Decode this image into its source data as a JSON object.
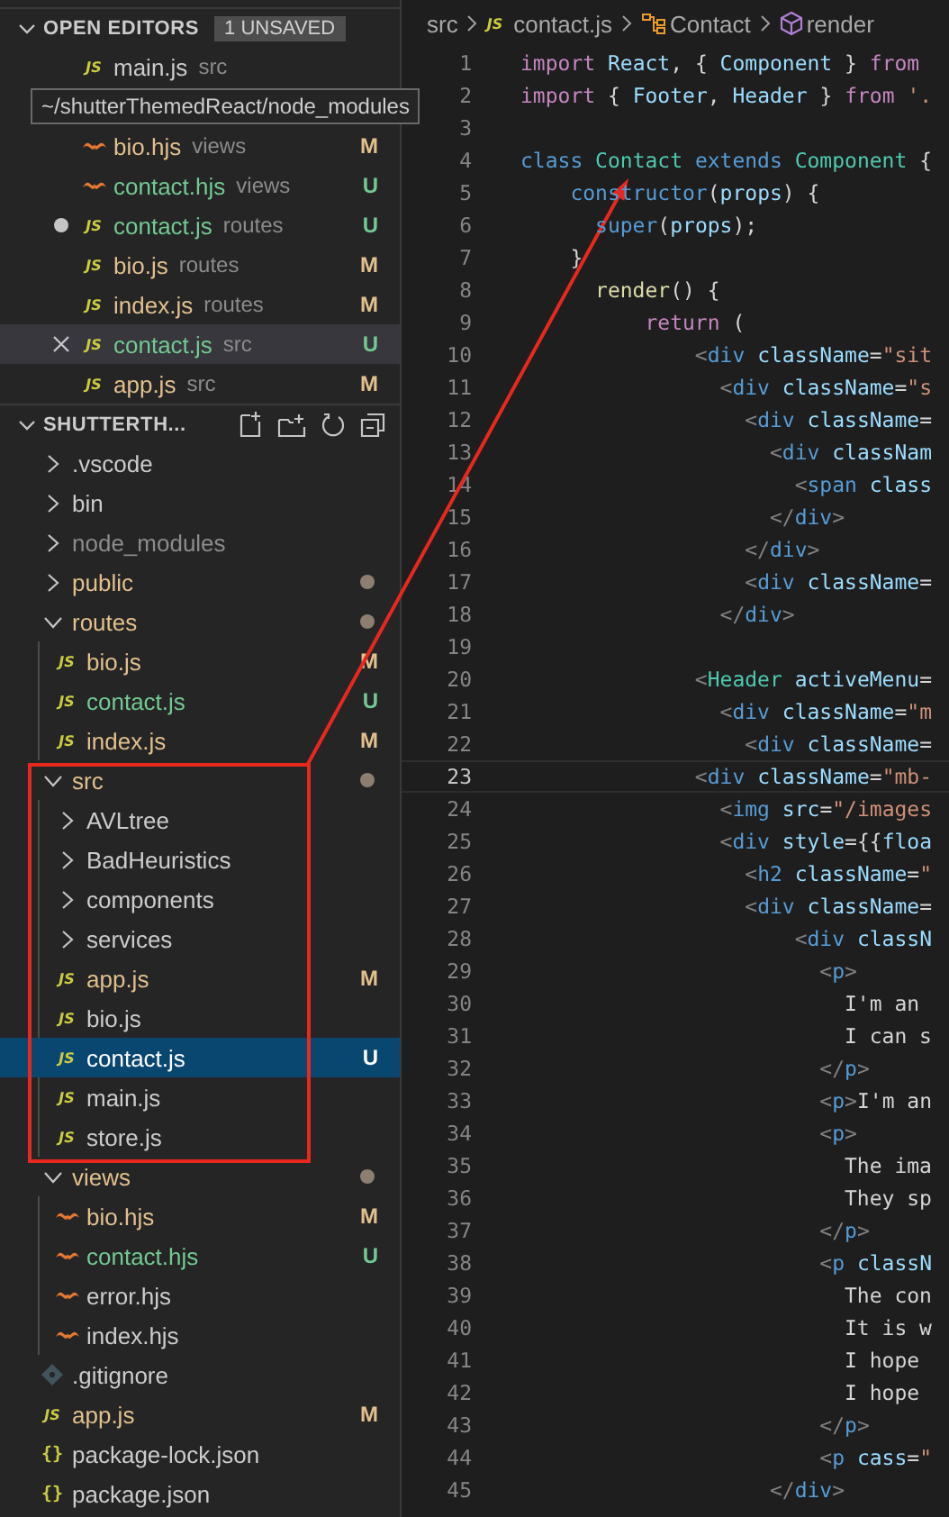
{
  "open_editors": {
    "title": "OPEN EDITORS",
    "badge": "1 UNSAVED",
    "expanded": true,
    "items": [
      {
        "name": "main.js",
        "folder": "src",
        "kind": "js",
        "glyph": "JS",
        "dirty": false,
        "selected": false
      },
      {
        "kind": "tooltip",
        "text": "~/shutterThemedReact/node_modules"
      },
      {
        "name": "bio.hjs",
        "folder": "views",
        "kind": "hbs",
        "color": "#e2c08d",
        "status": "M",
        "dirty": false,
        "selected": false
      },
      {
        "name": "contact.hjs",
        "folder": "views",
        "kind": "hbs",
        "color": "#73c991",
        "status": "U",
        "dirty": false,
        "selected": false
      },
      {
        "name": "contact.js",
        "folder": "routes",
        "kind": "js",
        "glyph": "JS",
        "color": "#73c991",
        "status": "U",
        "dirty": true,
        "selected": false
      },
      {
        "name": "bio.js",
        "folder": "routes",
        "kind": "js",
        "glyph": "JS",
        "color": "#e2c08d",
        "status": "M",
        "dirty": false,
        "selected": false
      },
      {
        "name": "index.js",
        "folder": "routes",
        "kind": "js",
        "glyph": "JS",
        "color": "#e2c08d",
        "status": "M",
        "dirty": false,
        "selected": false
      },
      {
        "name": "contact.js",
        "folder": "src",
        "kind": "js",
        "glyph": "JS",
        "color": "#73c991",
        "status": "U",
        "dirty": false,
        "selected": true
      },
      {
        "name": "app.js",
        "folder": "src",
        "kind": "js",
        "glyph": "JS",
        "color": "#e2c08d",
        "status": "M",
        "dirty": false,
        "selected": false
      }
    ]
  },
  "explorer": {
    "title": "SHUTTERTH...",
    "expanded": true,
    "tree": [
      {
        "name": ".vscode",
        "kind": "folder",
        "expanded": false,
        "selected": false
      },
      {
        "name": "bin",
        "kind": "folder",
        "expanded": false,
        "selected": false
      },
      {
        "name": "node_modules",
        "kind": "folder",
        "expanded": false,
        "ignored": true,
        "selected": false
      },
      {
        "name": "public",
        "kind": "folder",
        "expanded": false,
        "color": "#e2c08d",
        "dot": true,
        "selected": false
      },
      {
        "name": "routes",
        "kind": "folder",
        "expanded": true,
        "color": "#e2c08d",
        "dot": true,
        "selected": false,
        "children": [
          {
            "name": "bio.js",
            "kind": "js",
            "glyph": "JS",
            "color": "#e2c08d",
            "status": "M",
            "selected": false
          },
          {
            "name": "contact.js",
            "kind": "js",
            "glyph": "JS",
            "color": "#73c991",
            "status": "U",
            "selected": false
          },
          {
            "name": "index.js",
            "kind": "js",
            "glyph": "JS",
            "color": "#e2c08d",
            "status": "M",
            "selected": false
          }
        ]
      },
      {
        "name": "src",
        "kind": "folder",
        "expanded": true,
        "color": "#e2c08d",
        "dot": true,
        "selected": false,
        "children": [
          {
            "name": "AVLtree",
            "kind": "folder",
            "expanded": false,
            "selected": false
          },
          {
            "name": "BadHeuristics",
            "kind": "folder",
            "expanded": false,
            "selected": false
          },
          {
            "name": "components",
            "kind": "folder",
            "expanded": false,
            "selected": false
          },
          {
            "name": "services",
            "kind": "folder",
            "expanded": false,
            "selected": false
          },
          {
            "name": "app.js",
            "kind": "js",
            "glyph": "JS",
            "color": "#e2c08d",
            "status": "M",
            "selected": false
          },
          {
            "name": "bio.js",
            "kind": "js",
            "glyph": "JS",
            "selected": false
          },
          {
            "name": "contact.js",
            "kind": "js",
            "glyph": "JS",
            "status": "U",
            "selected": true
          },
          {
            "name": "main.js",
            "kind": "js",
            "glyph": "JS",
            "selected": false
          },
          {
            "name": "store.js",
            "kind": "js",
            "glyph": "JS",
            "selected": false
          }
        ]
      },
      {
        "name": "views",
        "kind": "folder",
        "expanded": true,
        "color": "#e2c08d",
        "dot": true,
        "selected": false,
        "children": [
          {
            "name": "bio.hjs",
            "kind": "hbs",
            "color": "#e2c08d",
            "status": "M",
            "selected": false
          },
          {
            "name": "contact.hjs",
            "kind": "hbs",
            "color": "#73c991",
            "status": "U",
            "selected": false
          },
          {
            "name": "error.hjs",
            "kind": "hbs",
            "selected": false
          },
          {
            "name": "index.hjs",
            "kind": "hbs",
            "selected": false
          }
        ]
      },
      {
        "name": ".gitignore",
        "kind": "git",
        "selected": false
      },
      {
        "name": "app.js",
        "kind": "js",
        "glyph": "JS",
        "color": "#e2c08d",
        "status": "M",
        "selected": false
      },
      {
        "name": "package-lock.json",
        "kind": "json",
        "glyph": "{}",
        "selected": false
      },
      {
        "name": "package.json",
        "kind": "json",
        "glyph": "{}",
        "selected": false
      }
    ]
  },
  "breadcrumb": [
    {
      "kind": "folder",
      "text": "src"
    },
    {
      "kind": "js",
      "glyph": "JS",
      "text": "contact.js"
    },
    {
      "kind": "class",
      "text": "Contact"
    },
    {
      "kind": "method",
      "text": "render"
    }
  ],
  "code": [
    {
      "n": "1",
      "active": false,
      "tokens": [
        {
          "kind": "kw",
          "text": "import"
        },
        {
          "kind": "var",
          "text": " React"
        },
        {
          "kind": "p",
          "text": ", { "
        },
        {
          "kind": "var",
          "text": "Component"
        },
        {
          "kind": "p",
          "text": " } "
        },
        {
          "kind": "kw",
          "text": "from"
        }
      ]
    },
    {
      "n": "2",
      "active": false,
      "tokens": [
        {
          "kind": "kw",
          "text": "import"
        },
        {
          "kind": "p",
          "text": " { "
        },
        {
          "kind": "var",
          "text": "Footer"
        },
        {
          "kind": "p",
          "text": ", "
        },
        {
          "kind": "var",
          "text": "Header"
        },
        {
          "kind": "p",
          "text": " } "
        },
        {
          "kind": "kw",
          "text": "from"
        },
        {
          "kind": "str",
          "text": " '."
        }
      ]
    },
    {
      "n": "3",
      "active": false
    },
    {
      "n": "4",
      "active": false,
      "tokens": [
        {
          "kind": "st",
          "text": "class"
        },
        {
          "kind": "ty",
          "text": " Contact"
        },
        {
          "kind": "st",
          "text": " extends"
        },
        {
          "kind": "ty",
          "text": " Component"
        },
        {
          "kind": "p",
          "text": " {"
        }
      ]
    },
    {
      "n": "5",
      "active": false,
      "tokens": [
        {
          "kind": "st",
          "text": "    constructor"
        },
        {
          "kind": "p",
          "text": "("
        },
        {
          "kind": "var",
          "text": "props"
        },
        {
          "kind": "p",
          "text": ") {"
        }
      ]
    },
    {
      "n": "6",
      "active": false,
      "tokens": [
        {
          "kind": "st",
          "text": "      super"
        },
        {
          "kind": "p",
          "text": "("
        },
        {
          "kind": "var",
          "text": "props"
        },
        {
          "kind": "p",
          "text": ");"
        }
      ]
    },
    {
      "n": "7",
      "active": false,
      "tokens": [
        {
          "kind": "p",
          "text": "    }"
        }
      ]
    },
    {
      "n": "8",
      "active": false,
      "tokens": [
        {
          "kind": "fn",
          "text": "      render"
        },
        {
          "kind": "p",
          "text": "() {"
        }
      ]
    },
    {
      "n": "9",
      "active": false,
      "tokens": [
        {
          "kind": "kw",
          "text": "          return"
        },
        {
          "kind": "p",
          "text": " ("
        }
      ]
    },
    {
      "n": "10",
      "active": false,
      "tokens": [
        {
          "kind": "tb",
          "text": "              <"
        },
        {
          "kind": "tag",
          "text": "div"
        },
        {
          "kind": "attr",
          "text": " className"
        },
        {
          "kind": "p",
          "text": "="
        },
        {
          "kind": "str",
          "text": "\"sit"
        }
      ]
    },
    {
      "n": "11",
      "active": false,
      "tokens": [
        {
          "kind": "tb",
          "text": "                <"
        },
        {
          "kind": "tag",
          "text": "div"
        },
        {
          "kind": "attr",
          "text": " className"
        },
        {
          "kind": "p",
          "text": "="
        },
        {
          "kind": "str",
          "text": "\"s"
        }
      ]
    },
    {
      "n": "12",
      "active": false,
      "tokens": [
        {
          "kind": "tb",
          "text": "                  <"
        },
        {
          "kind": "tag",
          "text": "div"
        },
        {
          "kind": "attr",
          "text": " className"
        },
        {
          "kind": "p",
          "text": "="
        }
      ]
    },
    {
      "n": "13",
      "active": false,
      "tokens": [
        {
          "kind": "tb",
          "text": "                    <"
        },
        {
          "kind": "tag",
          "text": "div"
        },
        {
          "kind": "attr",
          "text": " classNam"
        }
      ]
    },
    {
      "n": "14",
      "active": false,
      "tokens": [
        {
          "kind": "tb",
          "text": "                      <"
        },
        {
          "kind": "tag",
          "text": "span"
        },
        {
          "kind": "attr",
          "text": " class"
        }
      ]
    },
    {
      "n": "15",
      "active": false,
      "tokens": [
        {
          "kind": "tb",
          "text": "                    </"
        },
        {
          "kind": "tag",
          "text": "div"
        },
        {
          "kind": "tb",
          "text": ">"
        }
      ]
    },
    {
      "n": "16",
      "active": false,
      "tokens": [
        {
          "kind": "tb",
          "text": "                  </"
        },
        {
          "kind": "tag",
          "text": "div"
        },
        {
          "kind": "tb",
          "text": ">"
        }
      ]
    },
    {
      "n": "17",
      "active": false,
      "tokens": [
        {
          "kind": "tb",
          "text": "                  <"
        },
        {
          "kind": "tag",
          "text": "div"
        },
        {
          "kind": "attr",
          "text": " className"
        },
        {
          "kind": "p",
          "text": "="
        }
      ]
    },
    {
      "n": "18",
      "active": false,
      "tokens": [
        {
          "kind": "tb",
          "text": "                </"
        },
        {
          "kind": "tag",
          "text": "div"
        },
        {
          "kind": "tb",
          "text": ">"
        }
      ]
    },
    {
      "n": "19",
      "active": false
    },
    {
      "n": "20",
      "active": false,
      "tokens": [
        {
          "kind": "tb",
          "text": "              <"
        },
        {
          "kind": "ty",
          "text": "Header"
        },
        {
          "kind": "attr",
          "text": " activeMenu"
        },
        {
          "kind": "p",
          "text": "="
        }
      ]
    },
    {
      "n": "21",
      "active": false,
      "tokens": [
        {
          "kind": "tb",
          "text": "                <"
        },
        {
          "kind": "tag",
          "text": "div"
        },
        {
          "kind": "attr",
          "text": " className"
        },
        {
          "kind": "p",
          "text": "="
        },
        {
          "kind": "str",
          "text": "\"m"
        }
      ]
    },
    {
      "n": "22",
      "active": false,
      "tokens": [
        {
          "kind": "tb",
          "text": "                  <"
        },
        {
          "kind": "tag",
          "text": "div"
        },
        {
          "kind": "attr",
          "text": " className"
        },
        {
          "kind": "p",
          "text": "="
        }
      ]
    },
    {
      "n": "23",
      "active": true,
      "tokens": [
        {
          "kind": "tb",
          "text": "              <"
        },
        {
          "kind": "tag",
          "text": "div"
        },
        {
          "kind": "attr",
          "text": " className"
        },
        {
          "kind": "p",
          "text": "="
        },
        {
          "kind": "str",
          "text": "\"mb-"
        }
      ]
    },
    {
      "n": "24",
      "active": false,
      "tokens": [
        {
          "kind": "tb",
          "text": "                <"
        },
        {
          "kind": "tag",
          "text": "img"
        },
        {
          "kind": "attr",
          "text": " src"
        },
        {
          "kind": "p",
          "text": "="
        },
        {
          "kind": "str",
          "text": "\"/images"
        }
      ]
    },
    {
      "n": "25",
      "active": false,
      "tokens": [
        {
          "kind": "tb",
          "text": "                <"
        },
        {
          "kind": "tag",
          "text": "div"
        },
        {
          "kind": "attr",
          "text": " style"
        },
        {
          "kind": "p",
          "text": "={{"
        },
        {
          "kind": "attr",
          "text": "floa"
        }
      ]
    },
    {
      "n": "26",
      "active": false,
      "tokens": [
        {
          "kind": "tb",
          "text": "                  <"
        },
        {
          "kind": "tag",
          "text": "h2"
        },
        {
          "kind": "attr",
          "text": " className"
        },
        {
          "kind": "p",
          "text": "="
        },
        {
          "kind": "str",
          "text": "\""
        }
      ]
    },
    {
      "n": "27",
      "active": false,
      "tokens": [
        {
          "kind": "tb",
          "text": "                  <"
        },
        {
          "kind": "tag",
          "text": "div"
        },
        {
          "kind": "attr",
          "text": " className"
        },
        {
          "kind": "p",
          "text": "="
        }
      ]
    },
    {
      "n": "28",
      "active": false,
      "tokens": [
        {
          "kind": "tb",
          "text": "                      <"
        },
        {
          "kind": "tag",
          "text": "div"
        },
        {
          "kind": "attr",
          "text": " classN"
        }
      ]
    },
    {
      "n": "29",
      "active": false,
      "tokens": [
        {
          "kind": "tb",
          "text": "                        <"
        },
        {
          "kind": "tag",
          "text": "p"
        },
        {
          "kind": "tb",
          "text": ">"
        }
      ]
    },
    {
      "n": "30",
      "active": false,
      "tokens": [
        {
          "kind": "tx",
          "text": "                          I'm an"
        }
      ]
    },
    {
      "n": "31",
      "active": false,
      "tokens": [
        {
          "kind": "tx",
          "text": "                          I can s"
        }
      ]
    },
    {
      "n": "32",
      "active": false,
      "tokens": [
        {
          "kind": "tb",
          "text": "                        </"
        },
        {
          "kind": "tag",
          "text": "p"
        },
        {
          "kind": "tb",
          "text": ">"
        }
      ]
    },
    {
      "n": "33",
      "active": false,
      "tokens": [
        {
          "kind": "tb",
          "text": "                        <"
        },
        {
          "kind": "tag",
          "text": "p"
        },
        {
          "kind": "tb",
          "text": ">"
        },
        {
          "kind": "tx",
          "text": "I'm an"
        }
      ]
    },
    {
      "n": "34",
      "active": false,
      "tokens": [
        {
          "kind": "tb",
          "text": "                        <"
        },
        {
          "kind": "tag",
          "text": "p"
        },
        {
          "kind": "tb",
          "text": ">"
        }
      ]
    },
    {
      "n": "35",
      "active": false,
      "tokens": [
        {
          "kind": "tx",
          "text": "                          The ima"
        }
      ]
    },
    {
      "n": "36",
      "active": false,
      "tokens": [
        {
          "kind": "tx",
          "text": "                          They sp"
        }
      ]
    },
    {
      "n": "37",
      "active": false,
      "tokens": [
        {
          "kind": "tb",
          "text": "                        </"
        },
        {
          "kind": "tag",
          "text": "p"
        },
        {
          "kind": "tb",
          "text": ">"
        }
      ]
    },
    {
      "n": "38",
      "active": false,
      "tokens": [
        {
          "kind": "tb",
          "text": "                        <"
        },
        {
          "kind": "tag",
          "text": "p"
        },
        {
          "kind": "attr",
          "text": " classN"
        }
      ]
    },
    {
      "n": "39",
      "active": false,
      "tokens": [
        {
          "kind": "tx",
          "text": "                          The con"
        }
      ]
    },
    {
      "n": "40",
      "active": false,
      "tokens": [
        {
          "kind": "tx",
          "text": "                          It is w"
        }
      ]
    },
    {
      "n": "41",
      "active": false,
      "tokens": [
        {
          "kind": "tx",
          "text": "                          I hope"
        }
      ]
    },
    {
      "n": "42",
      "active": false,
      "tokens": [
        {
          "kind": "tx",
          "text": "                          I hope"
        }
      ]
    },
    {
      "n": "43",
      "active": false,
      "tokens": [
        {
          "kind": "tb",
          "text": "                        </"
        },
        {
          "kind": "tag",
          "text": "p"
        },
        {
          "kind": "tb",
          "text": ">"
        }
      ]
    },
    {
      "n": "44",
      "active": false,
      "tokens": [
        {
          "kind": "tb",
          "text": "                        <"
        },
        {
          "kind": "tag",
          "text": "p"
        },
        {
          "kind": "attr",
          "text": " cass"
        },
        {
          "kind": "p",
          "text": "="
        },
        {
          "kind": "str",
          "text": "\""
        }
      ]
    },
    {
      "n": "45",
      "active": false,
      "tokens": [
        {
          "kind": "tb",
          "text": "                    </"
        },
        {
          "kind": "tag",
          "text": "div"
        },
        {
          "kind": "tb",
          "text": ">"
        }
      ]
    }
  ]
}
